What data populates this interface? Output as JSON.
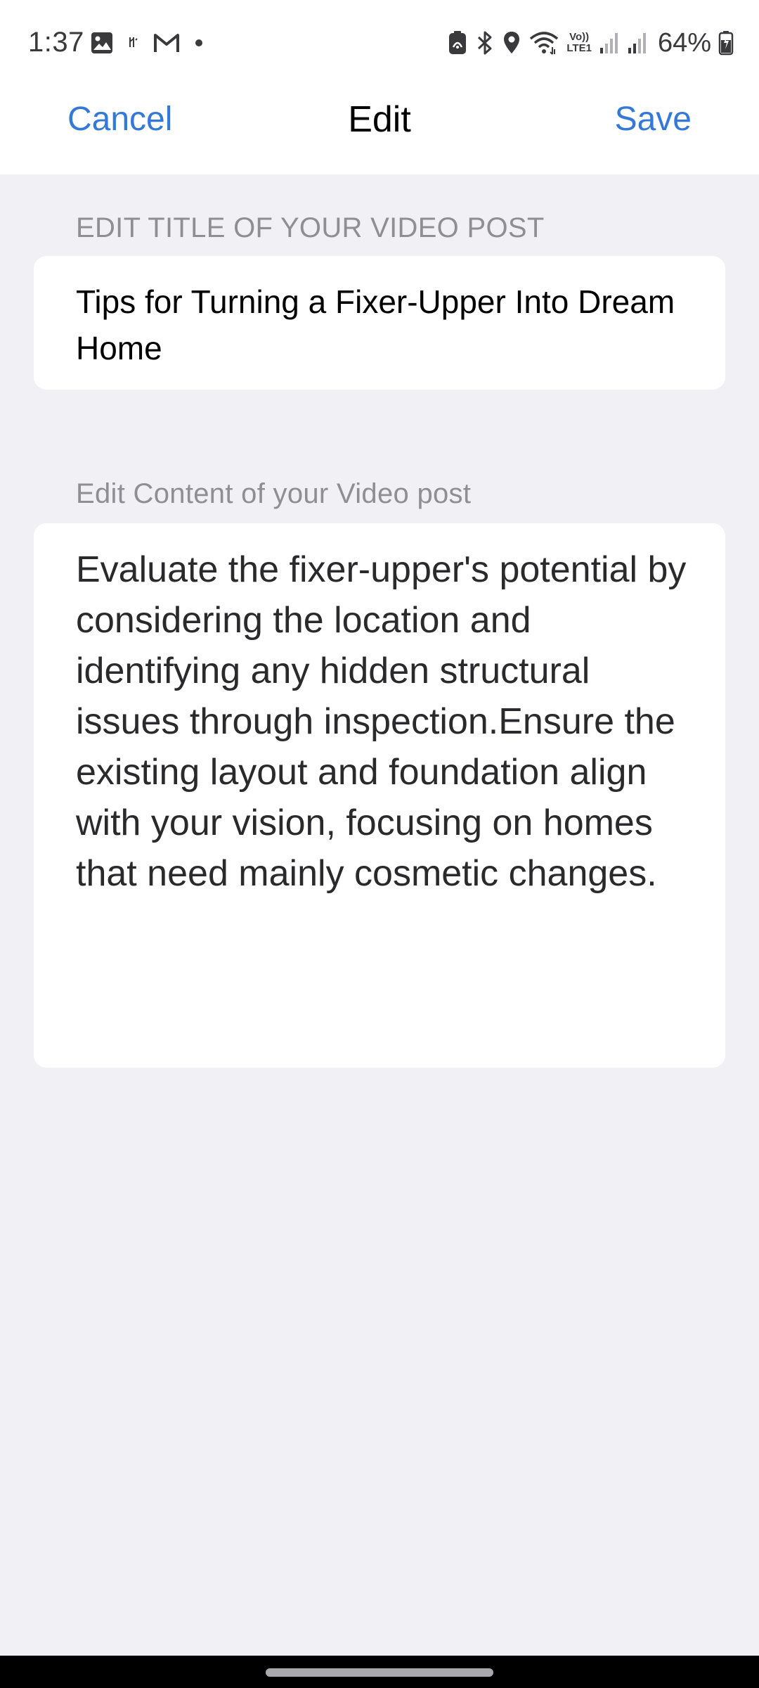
{
  "status_bar": {
    "time": "1:37",
    "battery": "64%",
    "left_icons": [
      "gallery-icon",
      "notification-small-icon",
      "gmail-icon",
      "dot-icon"
    ],
    "right_icons": [
      "battery-saver-icon",
      "bluetooth-icon",
      "location-icon",
      "wifi-icon",
      "volte-icon",
      "signal-1-icon",
      "signal-2-icon",
      "battery-icon"
    ],
    "volte_label_top": "Vo))",
    "volte_label_bottom": "LTE1"
  },
  "nav": {
    "cancel_label": "Cancel",
    "title": "Edit",
    "save_label": "Save",
    "accent_color": "#3478d8"
  },
  "form": {
    "title_label": "EDIT TITLE OF YOUR VIDEO POST",
    "title_value": "Tips for Turning a Fixer-Upper Into Dream Home",
    "content_label": "Edit Content of your Video post",
    "content_value": "Evaluate the fixer-upper's potential by considering the location and identifying any hidden structural issues through inspection.Ensure the existing layout and foundation align with your vision, focusing on homes that need mainly cosmetic changes."
  },
  "colors": {
    "background": "#f0f0f5",
    "card": "#ffffff",
    "label": "#8e8e93"
  }
}
